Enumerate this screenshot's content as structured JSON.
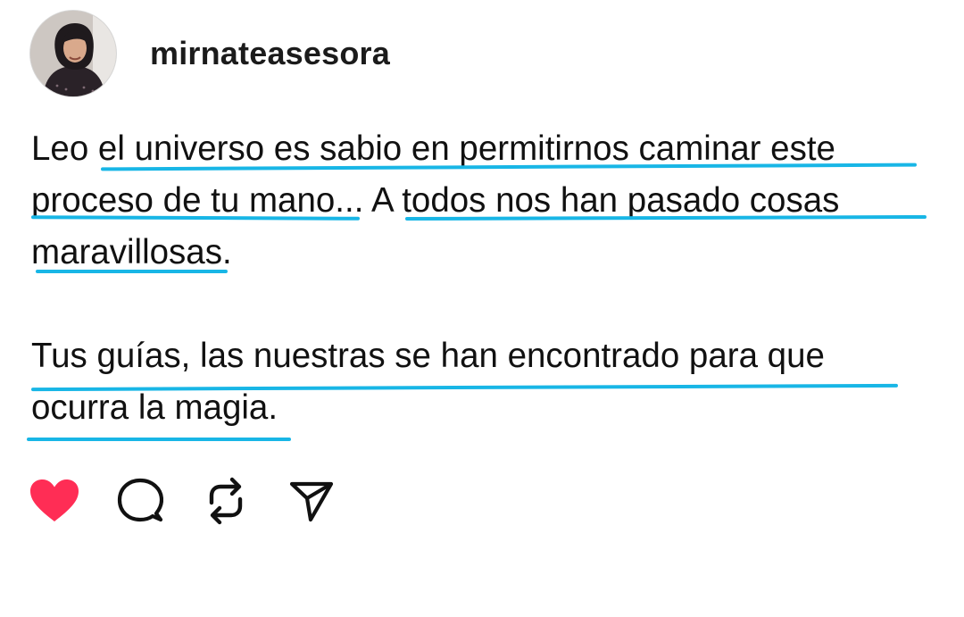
{
  "post": {
    "username": "mirnateasesora",
    "text_lines": [
      "Leo el universo es sabio en permitirnos caminar este",
      "proceso de tu mano... A todos nos han pasado cosas",
      "maravillosas.",
      "",
      "Tus guías, las nuestras se han encontrado para que",
      "ocurra la magia."
    ]
  },
  "actions": [
    {
      "icon": "heart-icon",
      "state": "liked",
      "color": "#ff2d55"
    },
    {
      "icon": "comment-icon"
    },
    {
      "icon": "repost-icon"
    },
    {
      "icon": "share-icon"
    }
  ],
  "colors": {
    "underline": "#18b6e6",
    "liked_heart": "#ff2d55"
  }
}
